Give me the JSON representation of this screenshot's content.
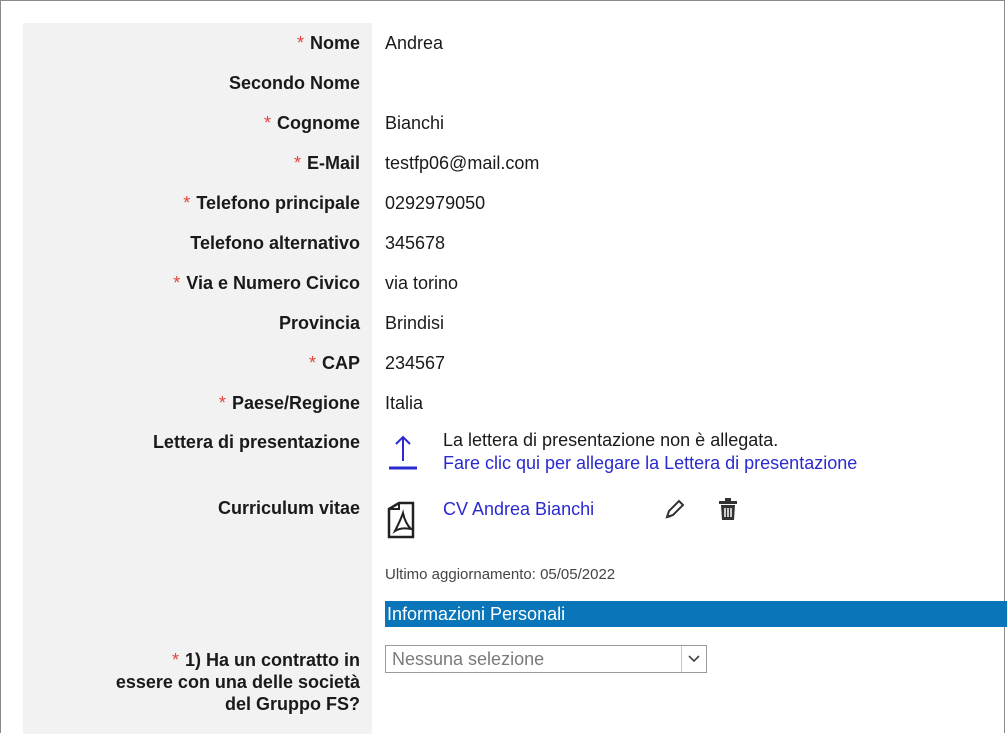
{
  "fields": [
    {
      "label": "Nome",
      "value": "Andrea"
    },
    {
      "label": "Secondo Nome",
      "value": ""
    },
    {
      "label": "Cognome",
      "value": "Bianchi"
    },
    {
      "label": "E-Mail",
      "value": "testfp06@mail.com"
    },
    {
      "label": "Telefono principale",
      "value": "0292979050"
    },
    {
      "label": "Telefono alternativo",
      "value": "345678"
    },
    {
      "label": "Via e Numero Civico",
      "value": "via torino"
    },
    {
      "label": "Provincia",
      "value": "Brindisi"
    },
    {
      "label": "CAP",
      "value": "234567"
    },
    {
      "label": "Paese/Regione",
      "value": "Italia"
    }
  ],
  "required_marker": "*",
  "cover_letter": {
    "label": "Lettera di presentazione",
    "status": "La lettera di presentazione non è allegata.",
    "link": "Fare clic qui per allegare la Lettera di presentazione",
    "icon": "upload-icon"
  },
  "cv": {
    "label": "Curriculum vitae",
    "file_link": "CV Andrea Bianchi",
    "last_update": "Ultimo aggiornamento: 05/05/2022",
    "icons": [
      "pdf-file-icon",
      "pencil-icon",
      "trash-icon"
    ]
  },
  "section": {
    "title": "Informazioni Personali",
    "color": "#0a76b9"
  },
  "question": {
    "label_line1": "1) Ha un contratto in",
    "label_line2": "essere con una delle società",
    "label_line3": "del Gruppo FS?",
    "select_value": "Nessuna selezione"
  },
  "colors": {
    "required": "#e0443b",
    "link": "#2a2ad0",
    "label_bg": "#f2f2f2"
  }
}
